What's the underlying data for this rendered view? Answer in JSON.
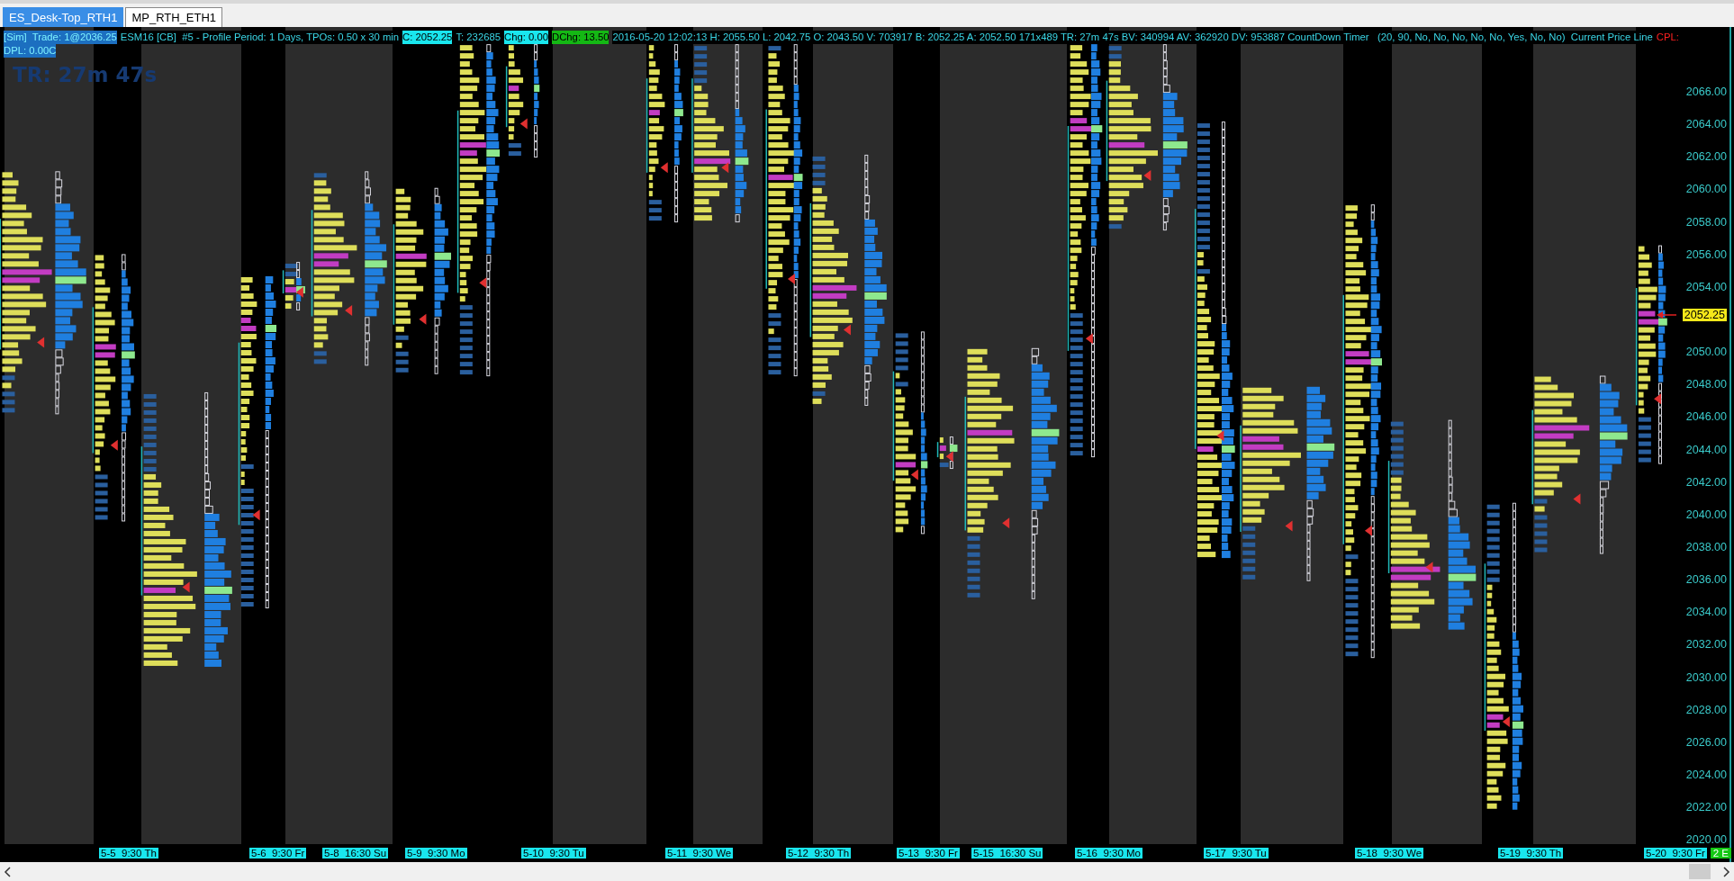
{
  "tabs": [
    {
      "label": "ES_Desk-Top_RTH1",
      "selected": true
    },
    {
      "label": "MP_RTH_ETH1",
      "selected": false
    }
  ],
  "info_bar": {
    "line_1": [
      {
        "kind": "badge",
        "text": "[Sim]  Trade: 1@2036.25"
      },
      {
        "kind": "plain",
        "text": "ESM16 [CB]  #5 - Profile Period: 1 Days, TPOs: 0.50 x 30 min"
      },
      {
        "kind": "highlight",
        "text": "C: 2052.25"
      },
      {
        "kind": "plain",
        "text": "T: 232685"
      },
      {
        "kind": "highlight",
        "text": "Chg: 0.00"
      },
      {
        "kind": "up",
        "text": "DChg: 13.50"
      },
      {
        "kind": "plain",
        "text": "2016-05-20 12:02:13 H: 2055.50 L: 2042.75 O: 2043.50 V: 703917 B: 2052.25 A: 2052.50 171x489 TR: 27m 47s BV: 340994 AV: 362920 DV: 953887 CountDown Timer   (20, 90, No, No, No, No, No, Yes, No, No)  Current Price Line"
      },
      {
        "kind": "alert",
        "text": "CPL:"
      }
    ],
    "line_2": [
      {
        "kind": "badge",
        "text": "DPL: 0.00C"
      }
    ]
  },
  "timer_overlay": "TR: 27m 47s",
  "price_axis": {
    "labels_upper": [
      "2066.00",
      "2064.00",
      "2062.00",
      "2060.00",
      "2058.00",
      "2056.00",
      "2054.00"
    ],
    "current_price": "2052.25",
    "labels_lower": [
      "2050.00",
      "2048.00",
      "2046.00",
      "2044.00",
      "2042.00",
      "2040.00",
      "2038.00",
      "2036.00",
      "2034.00",
      "2032.00",
      "2030.00",
      "2028.00",
      "2026.00",
      "2024.00",
      "2022.00",
      "2020.00"
    ]
  },
  "time_axis": {
    "labels": [
      "5-5  9:30 Th",
      "5-6  9:30 Fr",
      "5-8  16:30 Su",
      "5-9  9:30 Mo",
      "5-10  9:30 Tu",
      "5-11  9:30 We",
      "5-12  9:30 Th",
      "5-13  9:30 Fr",
      "5-15  16:30 Su",
      "5-16  9:30 Mo",
      "5-17  9:30 Tu",
      "5-18  9:30 We",
      "5-19  9:30 Th",
      "5-20  9:30 Fr"
    ],
    "end_badge": "2 E"
  }
}
